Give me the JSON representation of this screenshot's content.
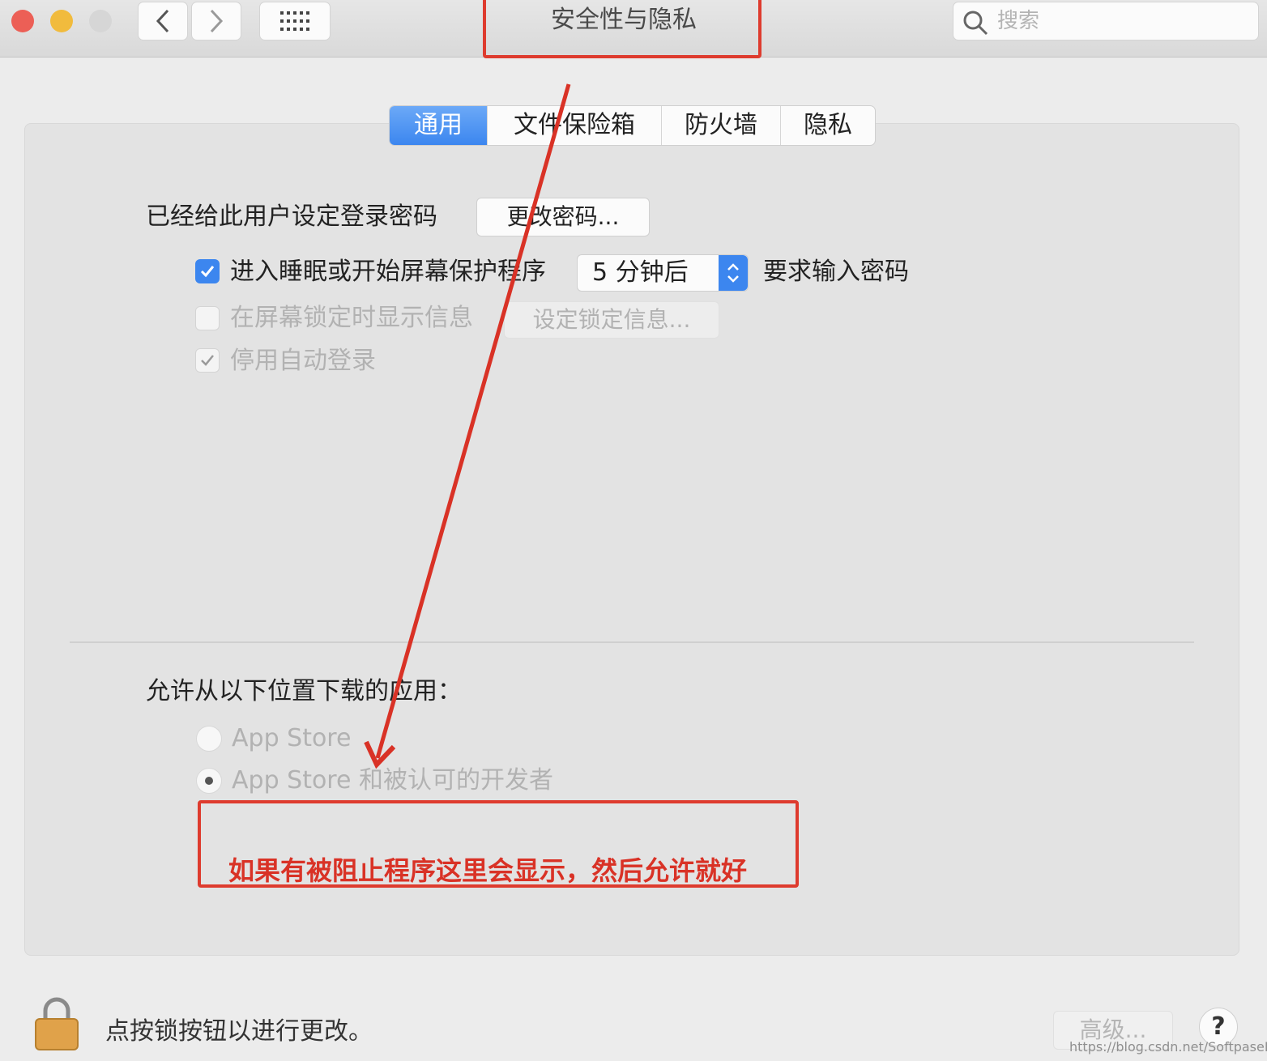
{
  "window": {
    "title": "安全性与隐私",
    "search_placeholder": "搜索"
  },
  "tabs": [
    {
      "label": "通用",
      "active": true
    },
    {
      "label": "文件保险箱",
      "active": false
    },
    {
      "label": "防火墙",
      "active": false
    },
    {
      "label": "隐私",
      "active": false
    }
  ],
  "general": {
    "password_set_label": "已经给此用户设定登录密码",
    "change_password_button": "更改密码...",
    "require_password": {
      "checked": true,
      "label_before": "进入睡眠或开始屏幕保护程序",
      "delay_value": "5 分钟后",
      "label_after": "要求输入密码"
    },
    "show_message": {
      "checked": false,
      "label": "在屏幕锁定时显示信息",
      "button": "设定锁定信息..."
    },
    "disable_auto_login": {
      "checked": true,
      "label": "停用自动登录"
    }
  },
  "downloads": {
    "heading": "允许从以下位置下载的应用：",
    "options": [
      {
        "label": "App Store",
        "selected": false
      },
      {
        "label": "App Store 和被认可的开发者",
        "selected": true
      }
    ]
  },
  "annotation": {
    "note": "如果有被阻止程序这里会显示，然后允许就好",
    "color": "#de3b2e"
  },
  "footer": {
    "lock_text": "点按锁按钮以进行更改。",
    "advanced_button": "高级...",
    "help_label": "?",
    "watermark": "https://blog.csdn.net/SoftpaseFar"
  },
  "colors": {
    "accent": "#3c86ef",
    "window_bg": "#ececec"
  }
}
